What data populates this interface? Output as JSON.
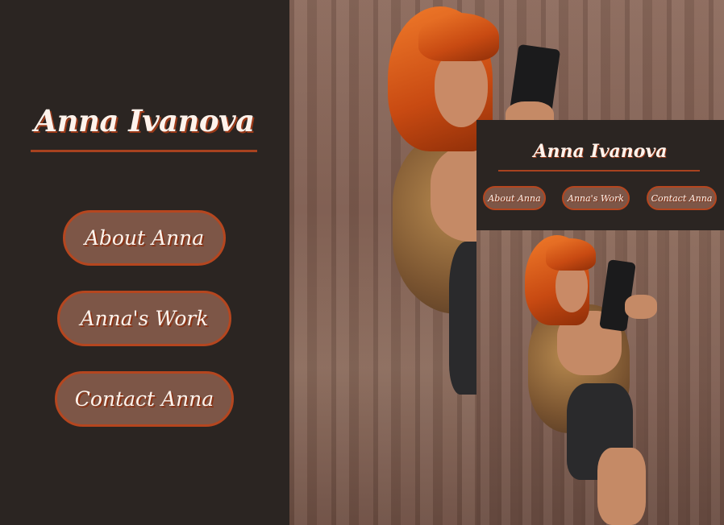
{
  "site": {
    "title": "Anna Ivanova"
  },
  "nav": {
    "items": [
      {
        "label": "About Anna"
      },
      {
        "label": "Anna's Work"
      },
      {
        "label": "Contact Anna"
      }
    ]
  },
  "popup": {
    "title": "Anna Ivanova",
    "items": [
      {
        "label": "About Anna"
      },
      {
        "label": "Anna's Work"
      },
      {
        "label": "Contact Anna"
      }
    ]
  },
  "colors": {
    "sidebar_bg": "#2b2522",
    "accent": "#b5461f",
    "button_fill": "#7d5647",
    "text": "#fdf3ec"
  },
  "photo": {
    "subject": "woman with orange bob haircut holding hair dryer"
  }
}
